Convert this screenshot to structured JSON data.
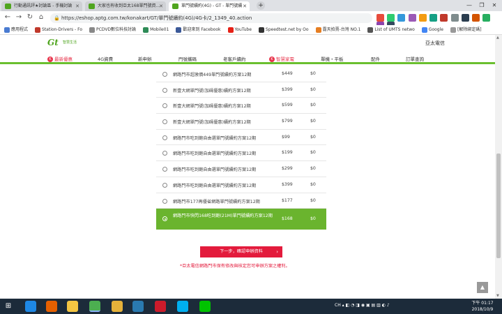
{
  "browser": {
    "tabs": [
      {
        "label": "行動通訊評★討論區 - 手機討論",
        "active": false,
        "icon_color": "#4fa51e"
      },
      {
        "label": "大家也有收到亞太168單門號資...",
        "active": false,
        "icon_color": "#4fa51e"
      },
      {
        "label": "單門號續約(4G) - GT - 單門號續",
        "active": true,
        "icon_color": "#4fa51e"
      }
    ],
    "new_tab_symbol": "+",
    "window_controls": {
      "minimize": "—",
      "maximize": "❐",
      "close": "✕"
    },
    "address": "https://eshop.aptg.com.tw/konakart/GT/單門號續約(4G)/4G卡/2_1349_40.action",
    "nav_icons": {
      "back": "←",
      "forward": "→",
      "reload": "↻",
      "home": "⌂"
    },
    "bookmarks": [
      {
        "label": "應用程式",
        "icon_color": "#4a7bd1"
      },
      {
        "label": "Station-Drivers - Fo",
        "icon_color": "#c0392b"
      },
      {
        "label": "PCDVD數位科技討論",
        "icon_color": "#888888"
      },
      {
        "label": "Mobile01",
        "icon_color": "#2e8b57"
      },
      {
        "label": "歡迎來到 Facebook",
        "icon_color": "#3b5998"
      },
      {
        "label": "YouTube",
        "icon_color": "#e62117"
      },
      {
        "label": "Speedtest.net by Oo",
        "icon_color": "#333333"
      },
      {
        "label": "露天拍賣-台灣 NO.1",
        "icon_color": "#e67e22"
      },
      {
        "label": "List of UMTS netwo",
        "icon_color": "#555555"
      },
      {
        "label": "Google",
        "icon_color": "#4285f4"
      },
      {
        "label": "[解除綁定碼]",
        "icon_color": "#999999"
      }
    ]
  },
  "site": {
    "logo_text": "Gt",
    "logo_sub": "智慧生活",
    "brand": "亞太電信",
    "nav": [
      {
        "label": "最新優惠",
        "hot": true,
        "badge": "K"
      },
      {
        "label": "4G資費",
        "hot": false
      },
      {
        "label": "新申辦",
        "hot": false
      },
      {
        "label": "門號攜碼",
        "hot": false
      },
      {
        "label": "老客戶續約",
        "hot": false
      },
      {
        "label": "智慧家電",
        "hot": true,
        "badge": "K"
      },
      {
        "label": "單機・平板",
        "hot": false
      },
      {
        "label": "配件",
        "hot": false
      },
      {
        "label": "訂單查詢",
        "hot": false
      }
    ]
  },
  "plans": [
    {
      "name": "網路門市超激價449單門號續約方案12期",
      "price": "$449",
      "fee": "$0",
      "selected": false
    },
    {
      "name": "新壹大網單門號(加碼優惠)續約方案12期",
      "price": "$399",
      "fee": "$0",
      "selected": false
    },
    {
      "name": "新壹大網單門號(加碼優惠)續約方案12期",
      "price": "$599",
      "fee": "$0",
      "selected": false
    },
    {
      "name": "新壹大網單門號(加碼優惠)續約方案12期",
      "price": "$799",
      "fee": "$0",
      "selected": false
    },
    {
      "name": "網路門市吃到飽自由選單門號續約方案12期",
      "price": "$99",
      "fee": "$0",
      "selected": false
    },
    {
      "name": "網路門市吃到飽自由選單門號續約方案12期",
      "price": "$199",
      "fee": "$0",
      "selected": false
    },
    {
      "name": "網路門市吃到飽自由選單門號續約方案12期",
      "price": "$299",
      "fee": "$0",
      "selected": false
    },
    {
      "name": "網路門市吃到飽自由選單門號續約方案12期",
      "price": "$399",
      "fee": "$0",
      "selected": false
    },
    {
      "name": "網路門市177再優省網路單門號續約方案12期",
      "price": "$177",
      "fee": "$0",
      "selected": false
    },
    {
      "name": "網路門市快閃168吃到飽(21M)單門號續約方案12期",
      "price": "$168",
      "fee": "$0",
      "selected": true
    }
  ],
  "next_button": {
    "label": "下一步，確認申辦資料",
    "arrow": "›"
  },
  "notice": "*亞太電信網路門市保有修改與核定您可申辦方案之權利。",
  "scroll_top": "▲",
  "taskbar": {
    "start": "⊞",
    "tray_text": "CH",
    "time": "下午 01:17",
    "date": "2018/10/9",
    "icons": [
      {
        "name": "ie",
        "color": "#1e88e5"
      },
      {
        "name": "firefox",
        "color": "#e66000"
      },
      {
        "name": "explorer",
        "color": "#f4c542"
      },
      {
        "name": "chrome",
        "color": "#4caf50"
      },
      {
        "name": "folder",
        "color": "#e6b23a"
      },
      {
        "name": "winlib",
        "color": "#2a7ab0"
      },
      {
        "name": "tool",
        "color": "#3d8ed4"
      },
      {
        "name": "opera",
        "color": "#cc1b2b"
      },
      {
        "name": "app",
        "color": "#6d6d6d"
      },
      {
        "name": "skype",
        "color": "#00aff0"
      },
      {
        "name": "files",
        "color": "#e3a12f"
      },
      {
        "name": "line",
        "color": "#00c300"
      }
    ]
  }
}
